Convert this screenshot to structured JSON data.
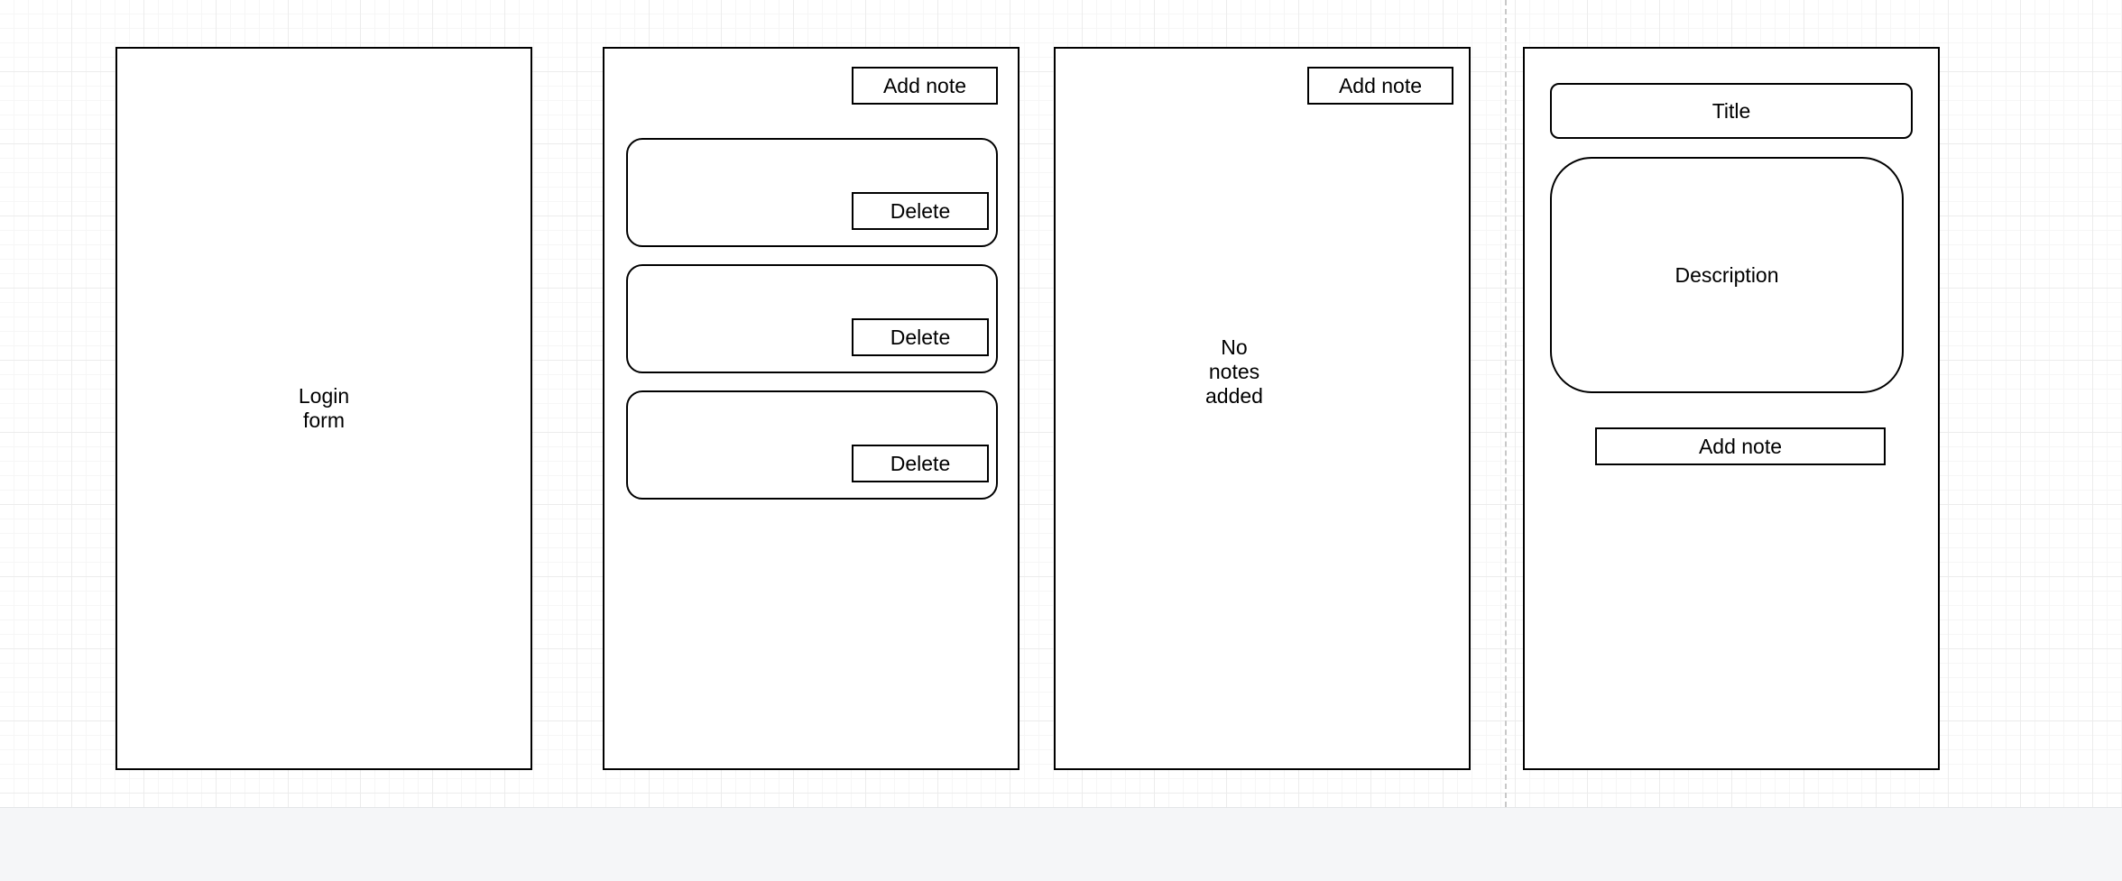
{
  "screens": {
    "login": {
      "label_line1": "Login",
      "label_line2": "form"
    },
    "notes_list": {
      "add_note_label": "Add note",
      "notes": [
        {
          "delete_label": "Delete"
        },
        {
          "delete_label": "Delete"
        },
        {
          "delete_label": "Delete"
        }
      ]
    },
    "empty_notes": {
      "add_note_label": "Add note",
      "empty_line1": "No",
      "empty_line2": "notes",
      "empty_line3": "added"
    },
    "add_note_form": {
      "title_field": "Title",
      "description_field": "Description",
      "submit_label": "Add note"
    }
  },
  "colors": {
    "stroke": "#000000",
    "canvas_bg": "#ffffff",
    "grid": "#ececec",
    "footer_bg": "#f5f6f8"
  }
}
